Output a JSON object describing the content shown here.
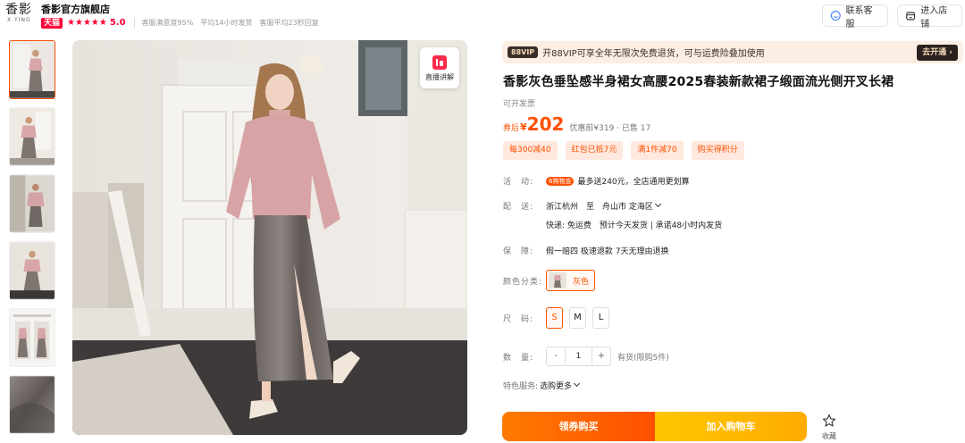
{
  "shop": {
    "logo_main": "香影",
    "logo_sub": "X.YING",
    "name": "香影官方旗舰店",
    "badge": "天猫",
    "stars": "★★★★★",
    "rating": "5.0",
    "metrics": [
      "客服满意度95%",
      "平均14小时发货",
      "客服平均23秒回复"
    ]
  },
  "header_buttons": {
    "service": "联系客服",
    "enter": "进入店铺"
  },
  "thumbnails": [
    {
      "name": "thumb-1",
      "active": true
    },
    {
      "name": "thumb-2",
      "active": false
    },
    {
      "name": "thumb-3",
      "active": false
    },
    {
      "name": "thumb-4",
      "active": false
    },
    {
      "name": "thumb-5",
      "active": false
    },
    {
      "name": "thumb-6",
      "active": false
    }
  ],
  "live_badge": "直播讲解",
  "vip": {
    "badge": "88VIP",
    "text": "开88VIP可享全年无限次免费退货，可与运费险叠加使用",
    "button": "去开通 ›"
  },
  "product": {
    "title": "香影灰色垂坠感半身裙女高腰2025春装新款裙子缎面流光侧开叉长裙",
    "invoice": "可开发票",
    "price_label": "券后",
    "currency": "¥",
    "price": "202",
    "price_before": "优惠前¥319 · 已售 17"
  },
  "promos": [
    "每300减40",
    "红包已抵7元",
    "满1件减70",
    "购买得积分"
  ],
  "activity": {
    "label": "活　动:",
    "tag": "6购物金",
    "text": "最多送240元，全店通用更划算"
  },
  "delivery": {
    "label": "配　送:",
    "route": "浙江杭州　至　舟山市 定海区",
    "detail": "快递: 免运费　预计今天发货 | 承诺48小时内发货"
  },
  "guarantee": {
    "label": "保　障:",
    "text": "假一赔四 极速退款 7天无理由退换"
  },
  "color": {
    "label": "颜色分类:",
    "option": "灰色"
  },
  "size": {
    "label": "尺　码:",
    "options": [
      "S",
      "M",
      "L"
    ],
    "selected": "S"
  },
  "quantity": {
    "label": "数　量:",
    "minus": "-",
    "value": "1",
    "plus": "+",
    "stock": "有货(限购5件)"
  },
  "services": {
    "label": "特色服务:",
    "text": "选购更多"
  },
  "actions": {
    "buy": "领券购买",
    "cart": "加入购物车",
    "favorite": "收藏"
  },
  "colors": {
    "accent": "#ff5000",
    "tmall": "#ff0036",
    "cart": "#ffb400"
  }
}
